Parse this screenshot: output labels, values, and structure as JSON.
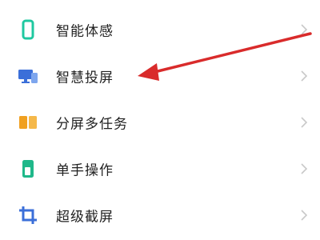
{
  "settings_list": {
    "items": [
      {
        "label": "智能体感",
        "icon": "phone-outline-icon",
        "color": "#1fc8a0"
      },
      {
        "label": "智慧投屏",
        "icon": "screen-cast-icon",
        "color": "#3b6fd9"
      },
      {
        "label": "分屏多任务",
        "icon": "split-screen-icon",
        "color": "#f0a020"
      },
      {
        "label": "单手操作",
        "icon": "one-hand-icon",
        "color": "#1fb88a"
      },
      {
        "label": "超级截屏",
        "icon": "crop-icon",
        "color": "#3b6fd9"
      }
    ]
  },
  "annotation": {
    "arrow_color": "#d92b2b",
    "points_to": "智慧投屏"
  },
  "chevron_color": "#c8c8c8"
}
